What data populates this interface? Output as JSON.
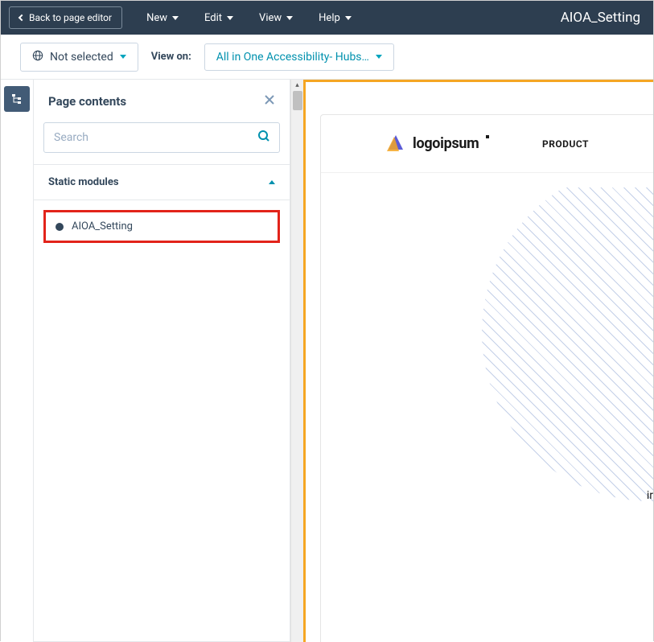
{
  "topbar": {
    "back_label": "Back to page editor",
    "menu": [
      "New",
      "Edit",
      "View",
      "Help"
    ],
    "title": "AIOA_Setting"
  },
  "subbar": {
    "globe_label": "Not selected",
    "view_on_label": "View on:",
    "view_on_value": "All in One Accessibility- Hubs…"
  },
  "sidebar": {
    "title": "Page contents",
    "search_placeholder": "Search",
    "section_title": "Static modules",
    "module_label": "AIOA_Setting"
  },
  "preview": {
    "logo_text": "logoipsum",
    "nav1": "PRODUCT",
    "partial": "ir"
  }
}
